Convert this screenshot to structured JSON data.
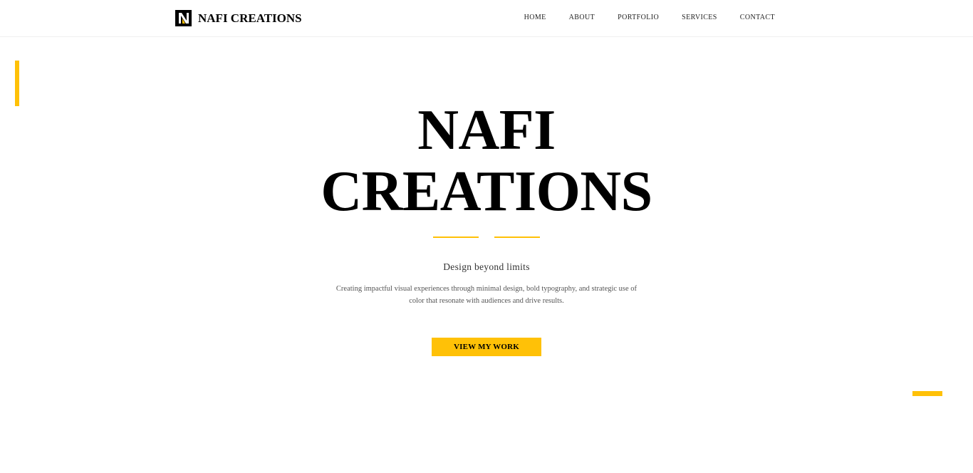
{
  "brand": {
    "name": "NAFI CREATIONS",
    "logo_icon": "letter-n-logo-icon"
  },
  "nav": {
    "items": [
      {
        "label": "HOME"
      },
      {
        "label": "ABOUT"
      },
      {
        "label": "PORTFOLIO"
      },
      {
        "label": "SERVICES"
      },
      {
        "label": "CONTACT"
      }
    ]
  },
  "hero": {
    "title_line1": "NAFI",
    "title_line2": "CREATIONS",
    "tagline": "Design beyond limits",
    "description": "Creating impactful visual experiences through minimal design, bold typography, and strategic use of color that resonate with audiences and drive results.",
    "cta_label": "VIEW MY WORK"
  },
  "colors": {
    "accent": "#ffc107",
    "text": "#000000",
    "background": "#ffffff"
  }
}
